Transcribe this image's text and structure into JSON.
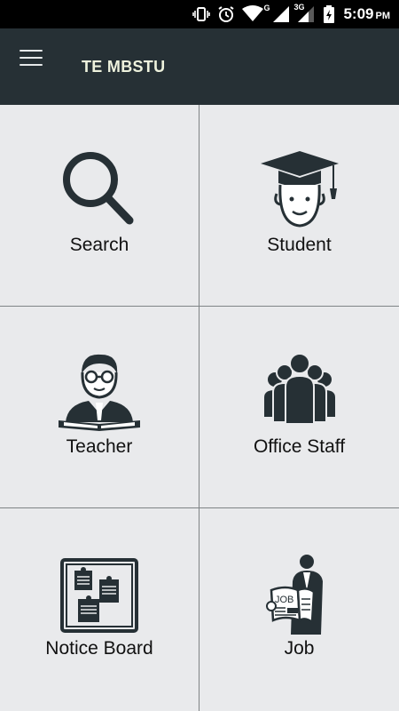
{
  "status_bar": {
    "time": "5:09",
    "ampm": "PM",
    "network_label": "G",
    "network_label_2": "3G",
    "icons": [
      "vibrate-icon",
      "alarm-icon",
      "wifi-icon",
      "signal-icon",
      "signal-icon",
      "battery-charging-icon"
    ]
  },
  "app_bar": {
    "menu_icon": "hamburger-menu-icon",
    "title": "TE MBSTU"
  },
  "tiles": [
    {
      "label": "Search",
      "icon": "search-icon"
    },
    {
      "label": "Student",
      "icon": "student-icon"
    },
    {
      "label": "Teacher",
      "icon": "teacher-icon"
    },
    {
      "label": "Office Staff",
      "icon": "office-staff-icon"
    },
    {
      "label": "Notice Board",
      "icon": "notice-board-icon"
    },
    {
      "label": "Job",
      "icon": "job-icon"
    }
  ],
  "colors": {
    "app_bar": "#263035",
    "background": "#e9eaec",
    "icon": "#263035",
    "divider": "#7f8486"
  }
}
